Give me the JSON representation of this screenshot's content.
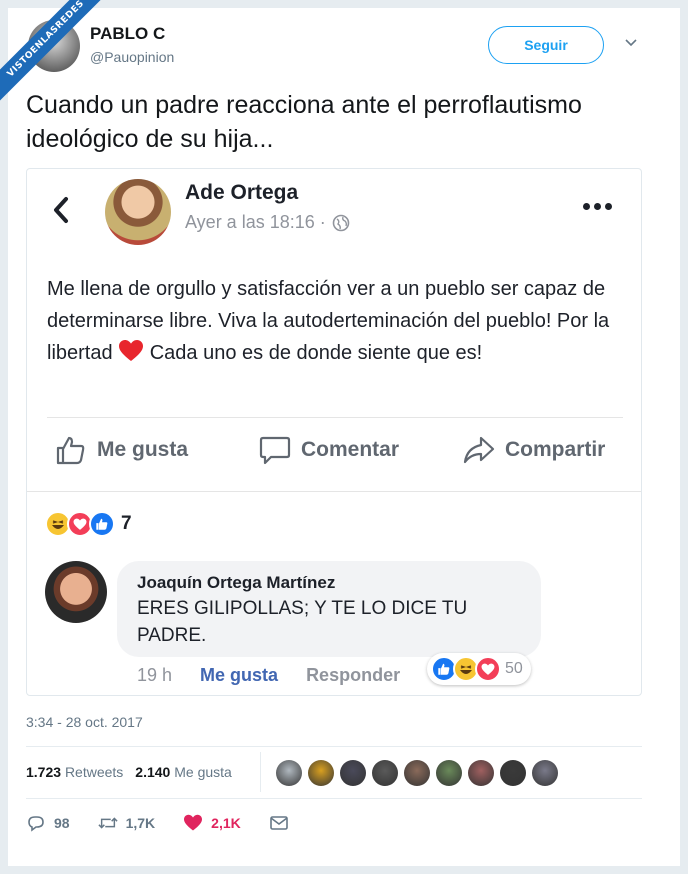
{
  "watermark": "VISTOENLASREDES",
  "author": {
    "name": "PABLO C",
    "handle": "@Pauopinion"
  },
  "follow_label": "Seguir",
  "tweet_text": "Cuando un padre reacciona ante el perroflautismo ideológico de su hija...",
  "fb_post": {
    "name": "Ade Ortega",
    "time": "Ayer a las 18:16 ·",
    "text_before_heart": "Me llena de orgullo y satisfacción ver a un pueblo ser capaz de determinarse libre. Viva la autoderteminación del pueblo! Por la libertad",
    "text_after_heart": "Cada uno es de donde siente que es!",
    "actions": {
      "like": "Me gusta",
      "comment": "Comentar",
      "share": "Compartir"
    },
    "reaction_count": "7",
    "comment": {
      "name": "Joaquín Ortega Martínez",
      "text": "ERES GILIPOLLAS; Y TE LO DICE TU PADRE.",
      "time": "19 h",
      "like": "Me gusta",
      "reply": "Responder",
      "reaction_count": "50"
    }
  },
  "timestamp": "3:34 - 28 oct. 2017",
  "stats": {
    "retweets_count": "1.723",
    "retweets_label": "Retweets",
    "likes_count": "2.140",
    "likes_label": "Me gusta"
  },
  "likers": [
    "#b0b8bf",
    "#d9a020",
    "#4a4a5a",
    "#5a5a5a",
    "#8a6a5a",
    "#6a8a5a",
    "#a06060",
    "#3a3a3a",
    "#7a7a8a"
  ],
  "bottom_actions": {
    "replies": "98",
    "retweets": "1,7K",
    "likes": "2,1K"
  },
  "colors": {
    "twitter_blue": "#1da1f2",
    "fb_blue": "#4267b2",
    "like_red": "#e0245e"
  }
}
